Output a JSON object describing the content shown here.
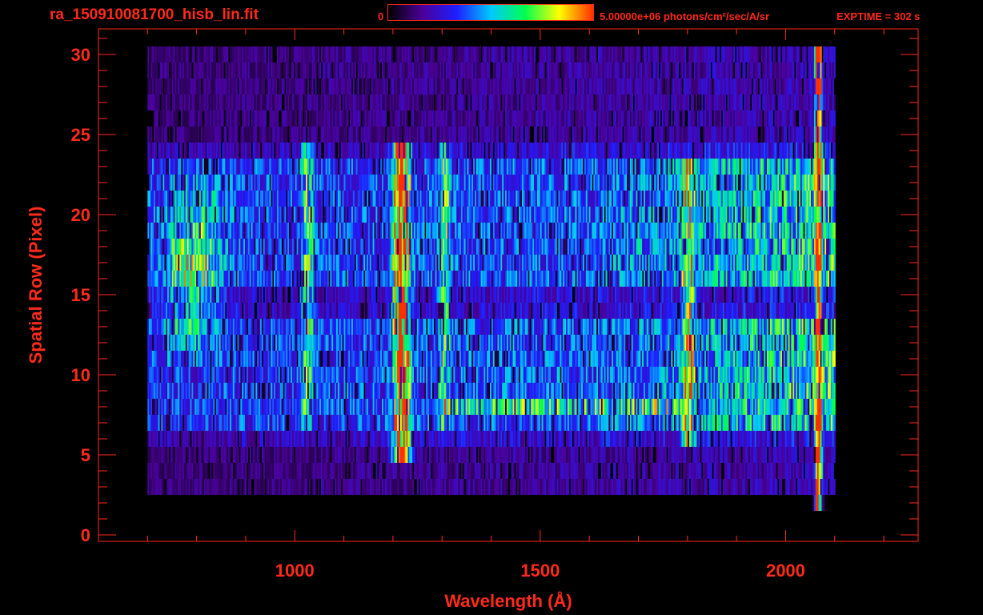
{
  "header": {
    "file_title": "ra_150910081700_hisb_lin.fit",
    "colorbar_min": "0",
    "colorbar_max": "5.00000e+06 photons/cm²/sec/A/sr",
    "exptime": "EXPTIME = 302 s"
  },
  "colors": {
    "axis": "#ff2a1a",
    "background": "#000000",
    "colormap": [
      "#000000",
      "#4b0099",
      "#1e1eff",
      "#00c8ff",
      "#00ff50",
      "#ffff00",
      "#ff3000"
    ]
  },
  "chart_data": {
    "type": "heatmap",
    "title": "ra_150910081700_hisb_lin.fit",
    "xlabel": "Wavelength (Å)",
    "ylabel": "Spatial Row (Pixel)",
    "xlim": [
      600,
      2270
    ],
    "ylim": [
      -0.4,
      31.6
    ],
    "x_ticks": [
      1000,
      1500,
      2000
    ],
    "y_ticks": [
      0,
      5,
      10,
      15,
      20,
      25,
      30
    ],
    "colorbar_range": [
      0,
      5000000
    ],
    "colorbar_units": "photons/cm²/sec/A/sr",
    "exptime_s": 302,
    "grid": false,
    "rows": [
      0,
      30
    ],
    "wavelength_range": [
      700,
      2100
    ],
    "features": [
      {
        "wavelength": 1216,
        "rows": [
          5,
          24
        ],
        "relative_level": 0.9
      },
      {
        "wavelength": 2065,
        "rows": [
          2,
          30
        ],
        "relative_level": 1.0
      },
      {
        "wavelength": 1025,
        "rows": [
          7,
          24
        ],
        "relative_level": 0.45
      },
      {
        "wavelength": 1304,
        "rows": [
          7,
          24
        ],
        "relative_level": 0.45
      },
      {
        "wavelength": 1800,
        "rows": [
          6,
          23
        ],
        "relative_level": 0.6
      }
    ]
  }
}
